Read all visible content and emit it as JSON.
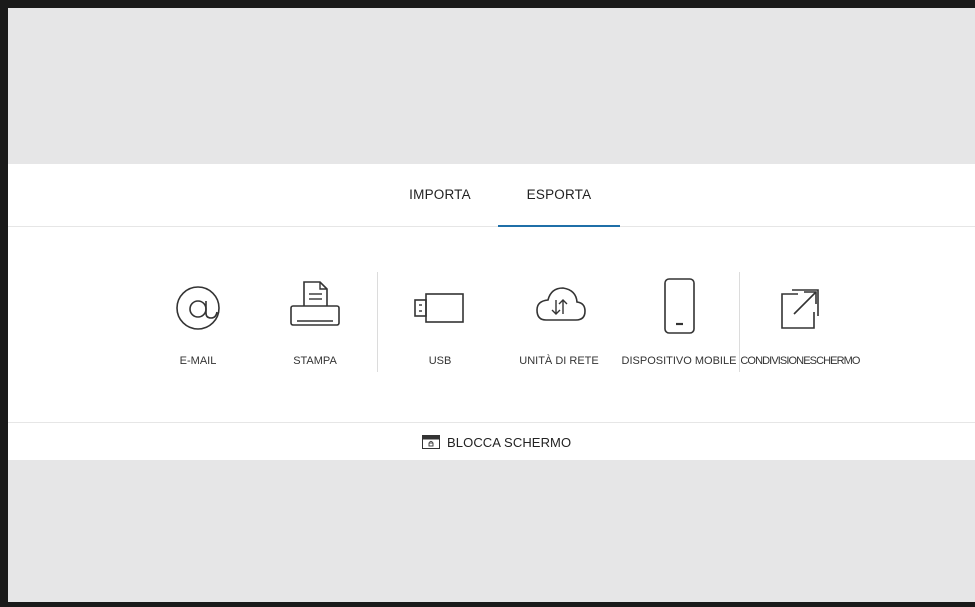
{
  "tabs": [
    {
      "label": "IMPORTA",
      "active": false
    },
    {
      "label": "ESPORTA",
      "active": true
    }
  ],
  "options": [
    {
      "label": "E-MAIL",
      "icon": "at-icon"
    },
    {
      "label": "STAMPA",
      "icon": "printer-icon"
    },
    {
      "label": "USB",
      "icon": "usb-icon"
    },
    {
      "label": "UNITÀ DI RETE",
      "icon": "cloud-transfer-icon"
    },
    {
      "label": "DISPOSITIVO MOBILE",
      "icon": "mobile-phone-icon"
    },
    {
      "label": "CONDIVISIONESCHERMO",
      "icon": "external-share-icon"
    }
  ],
  "lock": {
    "label": "BLOCCA SCHERMO",
    "icon": "lock-screen-icon"
  },
  "colors": {
    "accent": "#1f6fa8",
    "background": "#e6e6e7",
    "panel": "#ffffff"
  }
}
